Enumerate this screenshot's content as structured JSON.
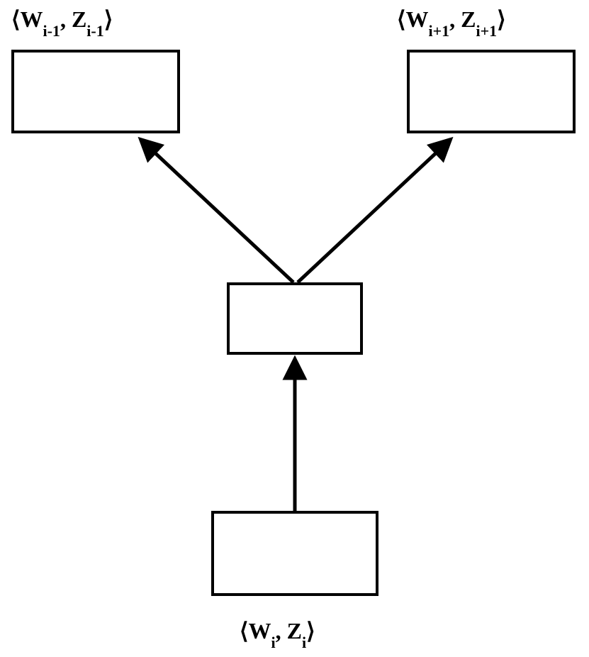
{
  "labels": {
    "topLeft": {
      "pre": "⟨W",
      "sub1": "i-1",
      "mid": ", Z",
      "sub2": "i-1",
      "post": "⟩"
    },
    "topRight": {
      "pre": "⟨W",
      "sub1": "i+1",
      "mid": ", Z",
      "sub2": "i+1",
      "post": "⟩"
    },
    "bottom": {
      "pre": "⟨W",
      "sub1": "i",
      "mid": ", Z",
      "sub2": "i",
      "post": "⟩"
    }
  }
}
